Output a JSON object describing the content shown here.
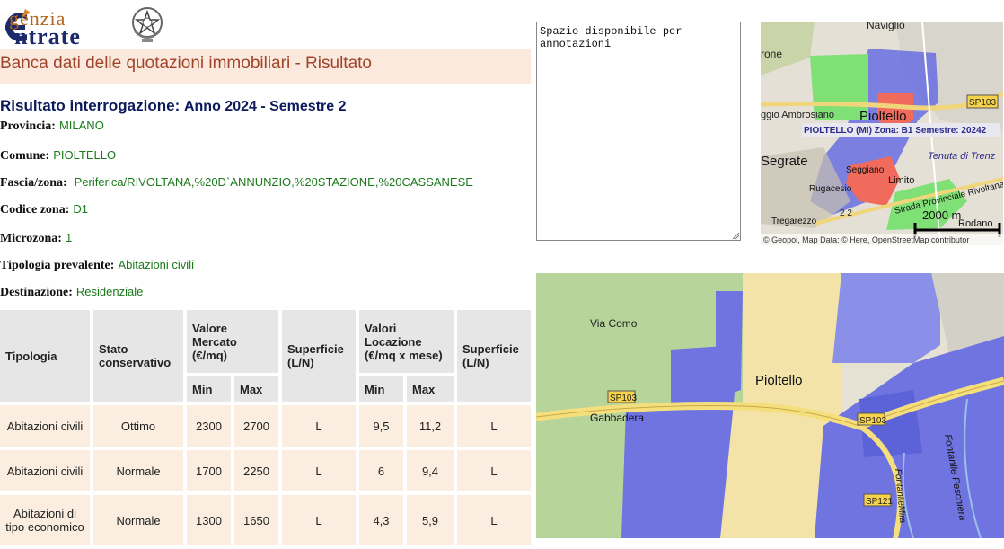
{
  "logo": {
    "line1": "genzia",
    "line2": "ntrate"
  },
  "banner": {
    "title": "Banca dati delle quotazioni immobiliari - Risultato"
  },
  "result": {
    "label": "Risultato interrogazione:",
    "value": "Anno 2024 - Semestre 2"
  },
  "fields": [
    {
      "label": "Provincia:",
      "value": "MILANO"
    },
    {
      "label": "Comune:",
      "value": "PIOLTELLO"
    },
    {
      "label": "Fascia/zona:",
      "value": "Periferica/RIVOLTANA,%20D`ANNUNZIO,%20STAZIONE,%20CASSANESE"
    },
    {
      "label": "Codice zona:",
      "value": "D1"
    },
    {
      "label": "Microzona:",
      "value": "1"
    },
    {
      "label": "Tipologia prevalente:",
      "value": "Abitazioni civili"
    },
    {
      "label": "Destinazione:",
      "value": "Residenziale"
    }
  ],
  "table": {
    "headers": {
      "tipologia": "Tipologia",
      "stato": "Stato conservativo",
      "valore_mercato": "Valore Mercato (€/mq)",
      "superficie": "Superficie (L/N)",
      "valori_locazione": "Valori Locazione (€/mq x mese)",
      "superficie2": "Superficie (L/N)",
      "min": "Min",
      "max": "Max"
    },
    "rows": [
      {
        "tipologia": "Abitazioni civili",
        "stato": "Ottimo",
        "vm_min": "2300",
        "vm_max": "2700",
        "sup": "L",
        "vl_min": "9,5",
        "vl_max": "11,2",
        "sup2": "L"
      },
      {
        "tipologia": "Abitazioni civili",
        "stato": "Normale",
        "vm_min": "1700",
        "vm_max": "2250",
        "sup": "L",
        "vl_min": "6",
        "vl_max": "9,4",
        "sup2": "L"
      },
      {
        "tipologia": "Abitazioni di tipo economico",
        "stato": "Normale",
        "vm_min": "1300",
        "vm_max": "1650",
        "sup": "L",
        "vl_min": "4,3",
        "vl_max": "5,9",
        "sup2": "L"
      }
    ]
  },
  "notes": {
    "text": "Spazio disponibile per annotazioni"
  },
  "map_small": {
    "labels": {
      "naviglio": "Naviglio",
      "rone": "rone",
      "ambrosiano": "ggio Ambrosiano",
      "pioltello": "Pioltello",
      "segrate": "Segrate",
      "seggiano": "Seggiano",
      "limito": "Limito",
      "rugacesio": "Rugacesio",
      "tenuta": "Tenuta di Trenz",
      "strada": "Strada Provinciale Rivoltana",
      "tregarezzo": "Tregarezzo",
      "rodano": "Rodano",
      "sp103": "SP103",
      "num": "2 2"
    },
    "zone_caption": "PIOLTELLO (MI) Zona: B1 Semestre: 20242",
    "scale": "2000 m",
    "attribution": "© Geopoi, Map Data: © Here, OpenStreetMap contributor"
  },
  "map_large": {
    "labels": {
      "via_como": "Via Como",
      "pioltello": "Pioltello",
      "gabbadera": "Gabbadera",
      "sp103a": "SP103",
      "sp103b": "SP103",
      "sp121": "SP121",
      "fontanile_peschiera": "Fontanile Peschiera",
      "fontanile_mira": "FontanileMira"
    }
  }
}
